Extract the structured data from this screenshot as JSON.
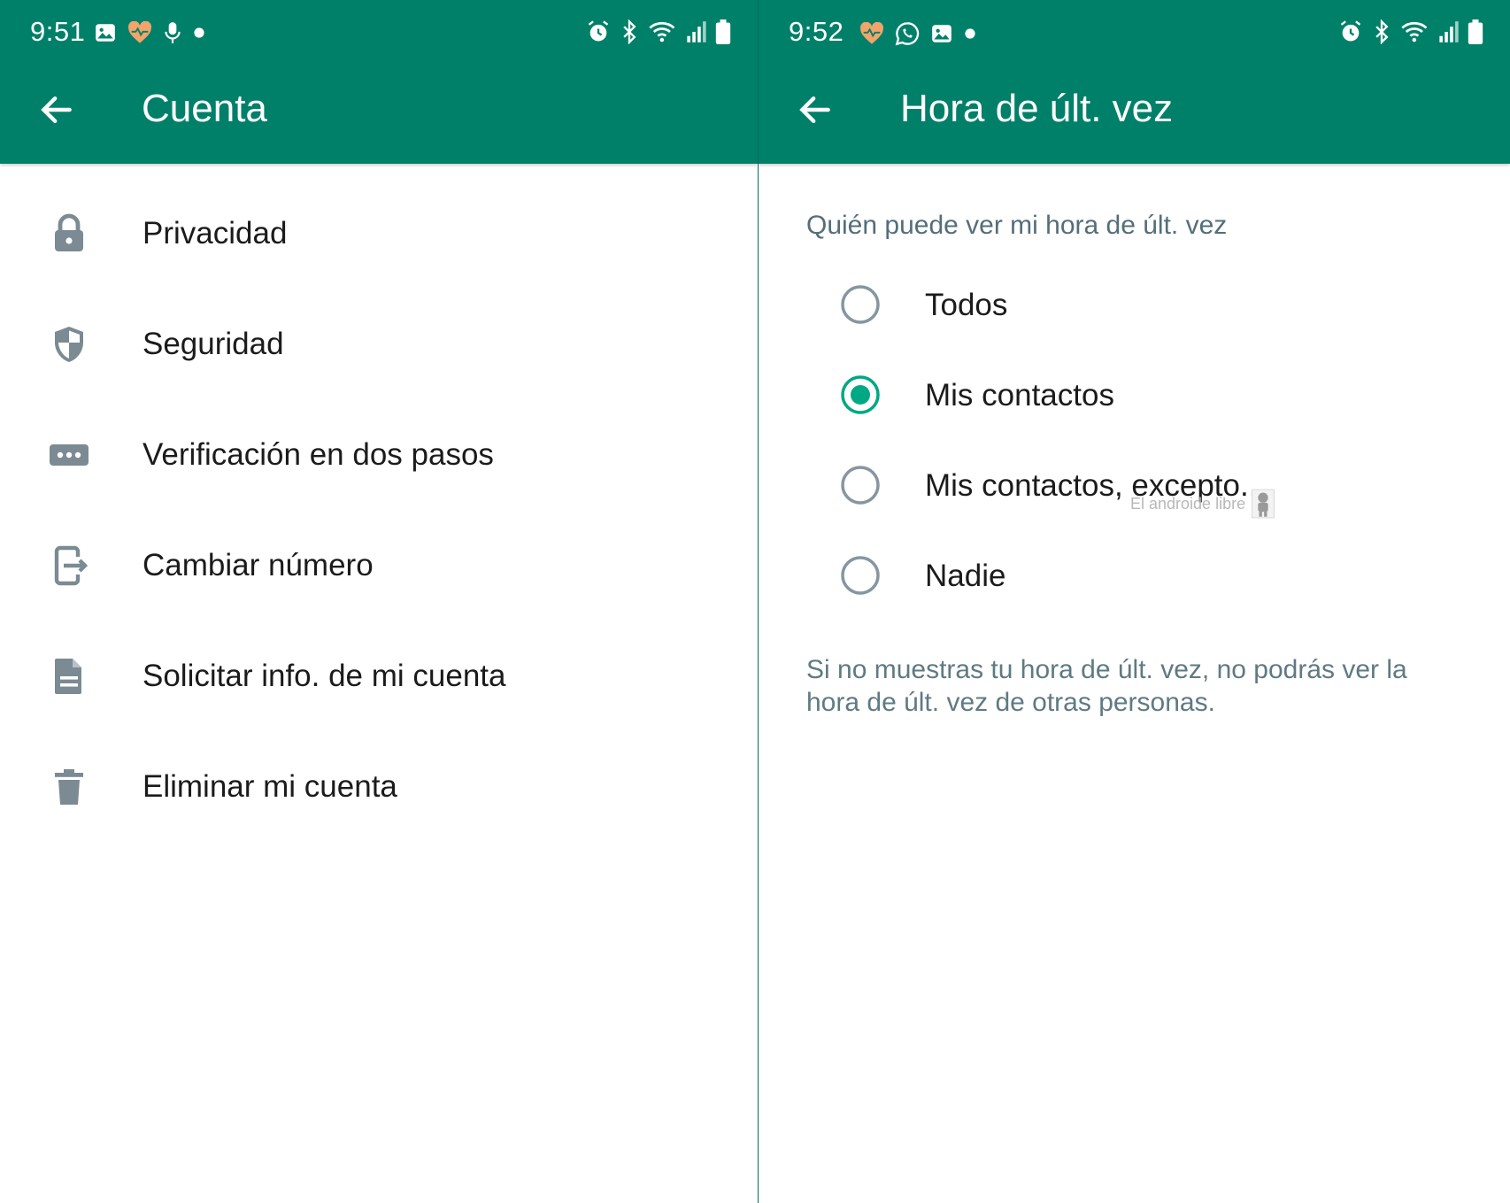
{
  "colors": {
    "brand": "#008069",
    "icon_grey": "#7b8a93",
    "radio_active": "#00a884",
    "radio_inactive": "#8696a0",
    "health_icon": "#f2a46b"
  },
  "left": {
    "status": {
      "time": "9:51",
      "icons_left": [
        "gallery-icon",
        "health-heart-icon",
        "microphone-icon",
        "dot-icon"
      ],
      "icons_right": [
        "alarm-icon",
        "bluetooth-icon",
        "wifi-icon",
        "signal-icon",
        "battery-icon"
      ]
    },
    "appbar": {
      "title": "Cuenta",
      "back_icon": "arrow-back-icon"
    },
    "menu": [
      {
        "label": "Privacidad",
        "icon": "lock-icon"
      },
      {
        "label": "Seguridad",
        "icon": "shield-icon"
      },
      {
        "label": "Verificación en dos pasos",
        "icon": "dots-password-icon"
      },
      {
        "label": "Cambiar número",
        "icon": "change-number-icon"
      },
      {
        "label": "Solicitar info. de mi cuenta",
        "icon": "document-icon"
      },
      {
        "label": "Eliminar mi cuenta",
        "icon": "trash-icon"
      }
    ]
  },
  "right": {
    "status": {
      "time": "9:52",
      "icons_left": [
        "health-heart-icon",
        "whatsapp-icon",
        "gallery-icon",
        "dot-icon"
      ],
      "icons_right": [
        "alarm-icon",
        "bluetooth-icon",
        "wifi-icon",
        "signal-icon",
        "battery-icon"
      ]
    },
    "appbar": {
      "title": "Hora de últ. vez",
      "back_icon": "arrow-back-icon"
    },
    "section_title": "Quién puede ver mi hora de últ. vez",
    "options": [
      {
        "label": "Todos",
        "selected": false
      },
      {
        "label": "Mis contactos",
        "selected": true
      },
      {
        "label": "Mis contactos, excepto...",
        "selected": false
      },
      {
        "label": "Nadie",
        "selected": false
      }
    ],
    "note": "Si no muestras tu hora de últ. vez, no podrás ver la hora de últ. vez de otras personas.",
    "watermark": "El androide libre"
  }
}
